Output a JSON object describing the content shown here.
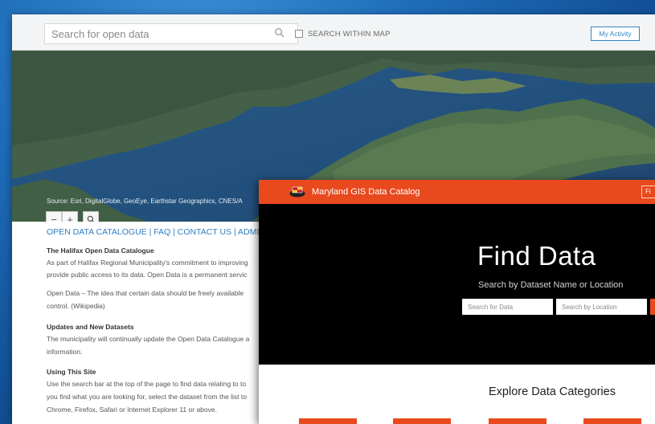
{
  "halifax": {
    "search_placeholder": "Search for open data",
    "search_within_label": "SEARCH WITHIN MAP",
    "my_activity_label": "My Activity",
    "zoom": {
      "out_label": "−",
      "in_label": "+"
    },
    "attribution": "Source: Esri, DigitalGlobe, GeoEye, Earthstar Geographics, CNES/A",
    "nav_links": "OPEN DATA CATALOGUE | FAQ | CONTACT US | ADMIN",
    "sections": [
      {
        "heading": "The Halifax Open Data Catalogue"
      },
      {
        "line": "As part of Halifax Regional Municipality's commitment to improving"
      },
      {
        "line": "provide public access to its data. Open Data is a permanent servic"
      },
      {
        "line": "Open Data – The idea that certain data should be freely available"
      },
      {
        "line": "control. (Wikipedia)"
      },
      {
        "heading": "Updates and New Datasets"
      },
      {
        "line": "The municipality will continually update the Open Data Catalogue a"
      },
      {
        "line": "information."
      },
      {
        "heading": "Using This Site"
      },
      {
        "line": "Use the search bar at the top of the page to find data relating to to"
      },
      {
        "line": "you find what you are looking for, select the dataset from the list to"
      },
      {
        "line": "Chrome, Firefox, Safari or Internet Explorer 11 or above."
      }
    ]
  },
  "maryland": {
    "title": "Maryland GIS Data Catalog",
    "top_right_label": "Fi",
    "hero_title": "Find Data",
    "hero_subtitle": "Search by Dataset Name or Location",
    "search_data_placeholder": "Search for Data",
    "search_location_placeholder": "Search by Location",
    "explore_title": "Explore Data Categories"
  },
  "colors": {
    "accent_orange": "#e8491d",
    "link_blue": "#2f7dbf",
    "desktop_blue": "#1e6cb8"
  },
  "icons": [
    "search-icon",
    "maryland-flag-logo",
    "checkbox-icon",
    "plus-icon",
    "minus-icon"
  ]
}
